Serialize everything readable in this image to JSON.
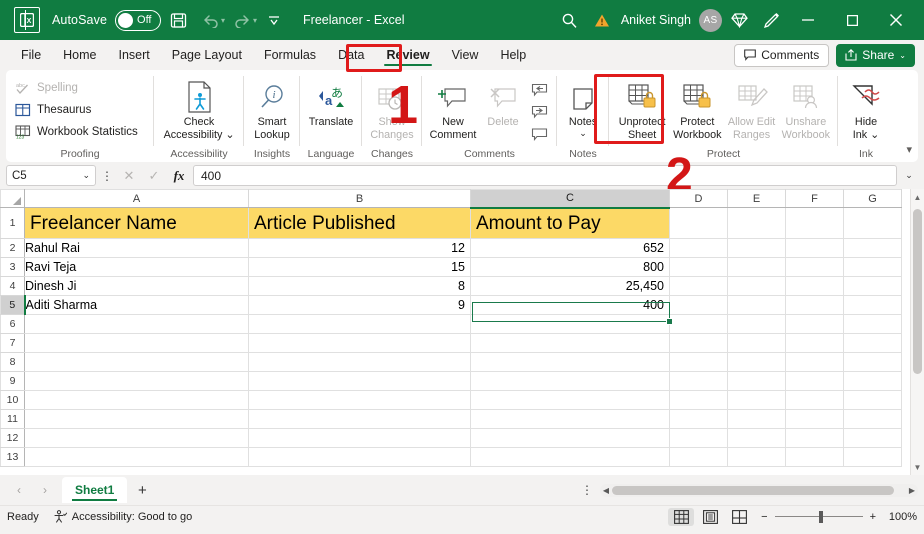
{
  "titlebar": {
    "app_icon": "excel-logo-icon",
    "autosave_label": "AutoSave",
    "autosave_state": "Off",
    "save_icon": "save-icon",
    "undo_icon": "undo-icon",
    "redo_icon": "redo-icon",
    "customize_icon": "customize-quick-access-icon",
    "document_title": "Freelancer  -  Excel",
    "search_icon": "search-icon",
    "warning_icon": "warning-triangle-icon",
    "user_name": "Aniket Singh",
    "user_initials": "AS",
    "diamond_icon": "diamond-icon",
    "pen_icon": "pen-icon",
    "minimize": "—",
    "maximize": "□",
    "close": "✕"
  },
  "tabs": [
    {
      "label": "File",
      "active": false
    },
    {
      "label": "Home",
      "active": false
    },
    {
      "label": "Insert",
      "active": false
    },
    {
      "label": "Page Layout",
      "active": false
    },
    {
      "label": "Formulas",
      "active": false
    },
    {
      "label": "Data",
      "active": false
    },
    {
      "label": "Review",
      "active": true
    },
    {
      "label": "View",
      "active": false
    },
    {
      "label": "Help",
      "active": false
    }
  ],
  "tabstrip_right": {
    "comments_label": "Comments",
    "comments_icon": "comment-icon",
    "share_label": "Share",
    "share_icon": "share-icon",
    "share_caret": "⌄"
  },
  "ribbon": {
    "groups": [
      {
        "title": "Proofing",
        "items": [
          {
            "label": "Spelling",
            "icon": "spelling-abc-check-icon",
            "disabled": true
          },
          {
            "label": "Thesaurus",
            "icon": "thesaurus-book-icon",
            "disabled": false
          },
          {
            "label": "Workbook Statistics",
            "icon": "workbook-statistics-icon",
            "disabled": false
          }
        ]
      },
      {
        "title": "Accessibility",
        "items": [
          {
            "label": "Check\nAccessibility",
            "label_line1": "Check",
            "label_line2": "Accessibility",
            "icon": "check-accessibility-icon",
            "caret": "⌄",
            "disabled": false
          }
        ]
      },
      {
        "title": "Insights",
        "items": [
          {
            "label_line1": "Smart",
            "label_line2": "Lookup",
            "icon": "smart-lookup-icon",
            "disabled": false
          }
        ]
      },
      {
        "title": "Language",
        "items": [
          {
            "label_line1": "Translate",
            "label_line2": "",
            "icon": "translate-icon",
            "disabled": false
          }
        ]
      },
      {
        "title": "Changes",
        "items": [
          {
            "label_line1": "Show",
            "label_line2": "Changes",
            "icon": "show-changes-icon",
            "disabled": true
          }
        ]
      },
      {
        "title": "Comments",
        "items": [
          {
            "label_line1": "New",
            "label_line2": "Comment",
            "icon": "new-comment-icon",
            "disabled": false
          },
          {
            "label_line1": "Delete",
            "label_line2": "",
            "icon": "delete-comment-icon",
            "disabled": true
          },
          {
            "icon": "previous-comment-icon",
            "disabled": false
          },
          {
            "icon": "next-comment-icon",
            "disabled": false
          },
          {
            "icon": "show-comments-icon",
            "disabled": false
          }
        ]
      },
      {
        "title": "Notes",
        "items": [
          {
            "label_line1": "Notes",
            "label_line2": "",
            "icon": "notes-icon",
            "caret": "⌄",
            "disabled": false
          }
        ]
      },
      {
        "title": "Protect",
        "items": [
          {
            "label_line1": "Unprotect",
            "label_line2": "Sheet",
            "icon": "unprotect-sheet-icon",
            "disabled": false,
            "highlighted": true
          },
          {
            "label_line1": "Protect",
            "label_line2": "Workbook",
            "icon": "protect-workbook-icon",
            "disabled": false
          },
          {
            "label_line1": "Allow Edit",
            "label_line2": "Ranges",
            "icon": "allow-edit-ranges-icon",
            "disabled": true
          },
          {
            "label_line1": "Unshare",
            "label_line2": "Workbook",
            "icon": "unshare-workbook-icon",
            "disabled": true
          }
        ]
      },
      {
        "title": "Ink",
        "items": [
          {
            "label_line1": "Hide",
            "label_line2": "Ink",
            "icon": "hide-ink-icon",
            "caret": "⌄",
            "disabled": false
          }
        ]
      }
    ],
    "collapse_icon": "collapse-ribbon-caret-icon"
  },
  "annotations": [
    {
      "name": "step-1",
      "text": "1"
    },
    {
      "name": "step-2",
      "text": "2"
    }
  ],
  "formula_bar": {
    "name_box_value": "C5",
    "name_box_caret": "⌄",
    "more_icon": "⋮",
    "cancel_icon": "✕",
    "enter_icon": "✓",
    "fx_icon": "fx",
    "formula_value": "400",
    "expand_caret": "⌄"
  },
  "grid": {
    "columns": [
      "A",
      "B",
      "C",
      "D",
      "E",
      "F",
      "G"
    ],
    "selected_column": "C",
    "selected_row": 5,
    "rows": [
      1,
      2,
      3,
      4,
      5,
      6,
      7,
      8,
      9,
      10,
      11,
      12,
      13
    ],
    "header_row": [
      "Freelancer Name",
      "Article Published",
      "Amount to Pay"
    ],
    "header_fill": "#fcd966",
    "data": [
      {
        "row": 2,
        "name": "Rahul Rai",
        "articles": "12",
        "amount": "652"
      },
      {
        "row": 3,
        "name": "Ravi Teja",
        "articles": "15",
        "amount": "800"
      },
      {
        "row": 4,
        "name": "Dinesh Ji",
        "articles": "8",
        "amount": "25,450"
      },
      {
        "row": 5,
        "name": "Aditi Sharma",
        "articles": "9",
        "amount": "400"
      }
    ],
    "active_cell": "C5",
    "scroll_up_icon": "▲",
    "scroll_down_icon": "▼"
  },
  "sheetbar": {
    "prev_icon": "‹",
    "next_icon": "›",
    "sheets": [
      {
        "label": "Sheet1",
        "active": true
      }
    ],
    "add_sheet_icon": "+",
    "more_icon": "⋮",
    "hscroll_left": "◀",
    "hscroll_right": "▶"
  },
  "statusbar": {
    "state": "Ready",
    "accessibility_icon": "accessibility-icon",
    "accessibility_text": "Accessibility: Good to go",
    "views": [
      {
        "name": "normal-view",
        "icon": "grid-view-icon",
        "active": true
      },
      {
        "name": "page-layout-view",
        "icon": "page-layout-icon",
        "active": false
      },
      {
        "name": "page-break-view",
        "icon": "page-break-icon",
        "active": false
      }
    ],
    "zoom_out": "−",
    "zoom_in": "+",
    "zoom_level": "100%"
  },
  "colors": {
    "excel_green": "#107c41",
    "annotation_red": "#e01b1b",
    "header_yellow": "#fcd966",
    "ribbon_bg": "#ffffff",
    "chrome_bg": "#f3f2f1"
  }
}
